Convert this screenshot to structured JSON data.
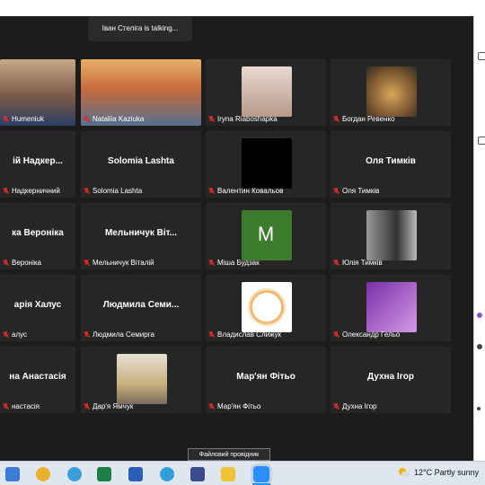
{
  "meeting": {
    "talking_banner": "Іван Стеліга is talking..."
  },
  "participants": [
    {
      "center": "",
      "label": "Humeniuk"
    },
    {
      "center": "",
      "label": "Nataliia Kaziuka"
    },
    {
      "center": "",
      "label": "Iryna Riaboshapka"
    },
    {
      "center": "",
      "label": "Богдан Ревенко"
    },
    {
      "center": "ій  Надкер...",
      "label": "Надкерничний"
    },
    {
      "center": "Solomia Lashta",
      "label": "Solomia Lashta"
    },
    {
      "center": "",
      "label": "Валентин Ковальов"
    },
    {
      "center": "Оля Тимків",
      "label": "Оля Тимків"
    },
    {
      "center": "ка Вероніка",
      "label": "Вероніка"
    },
    {
      "center": "Мельничук  Віт...",
      "label": "Мельничук Віталій"
    },
    {
      "center": "M",
      "label": "Міша Будзак"
    },
    {
      "center": "",
      "label": "Юлія Тимків"
    },
    {
      "center": "арія Халус",
      "label": "алус"
    },
    {
      "center": "Людмила  Семи...",
      "label": "Людмила Семирга"
    },
    {
      "center": "",
      "label": "Владислав Слижук"
    },
    {
      "center": "",
      "label": "Олександр Гельо"
    },
    {
      "center": "на Анастасія",
      "label": "настасія"
    },
    {
      "center": "",
      "label": "Дар'я Ямчук"
    },
    {
      "center": "Мар'ян Фітьо",
      "label": "Мар'ян Фітьо"
    },
    {
      "center": "Духна Ігор",
      "label": "Духна Ігор"
    }
  ],
  "taskbar": {
    "tooltip": "Файловий провідник",
    "weather": "12°C  Partly sunny"
  },
  "colors": {
    "meeting_bg": "#1c1c1c",
    "tile_bg": "#262626",
    "avatar_green": "#3c7a2e",
    "mute_red": "#e02b2b"
  }
}
